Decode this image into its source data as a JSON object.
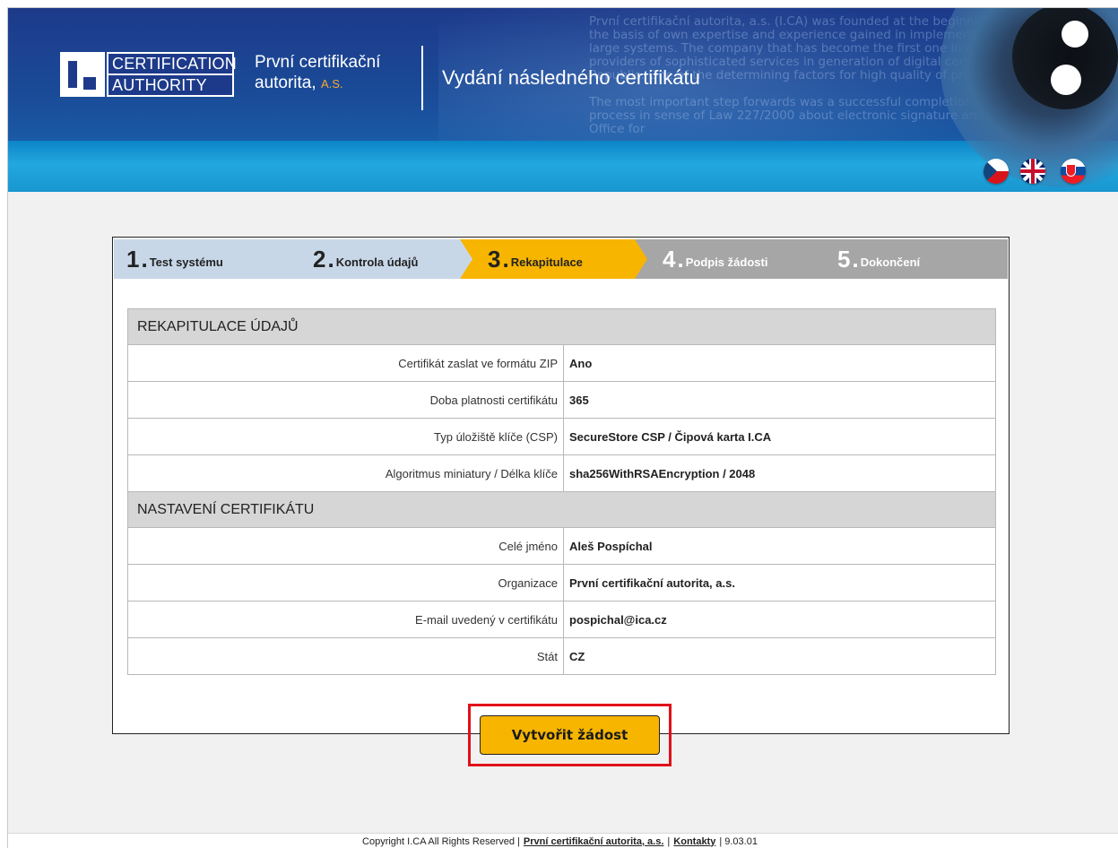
{
  "header": {
    "logo_line1": "CERTIFICATION",
    "logo_line2": "AUTHORITY",
    "org_name_line1": "První certifikační",
    "org_name_line2": "autorita,",
    "org_name_suffix": "A.S.",
    "page_title": "Vydání následného certifikátu",
    "bg_text_1": "První certifikační autorita, a.s. (I.CA) was founded at the beginning of the year 2001 on the basis of own expertise and experience gained in implementation and operation of large systems. The company that has become the first one in a field of commercial providers of sophisticated services in generation of digital certificates in the Czech Republic. One of the determining factors for high quality of provided services.",
    "bg_text_2": "The most important step forwards was a successful completion of accreditation process in sense of Law 227/2000 about electronic signature and coherent edicts. The Office for",
    "languages": [
      "cz-flag-icon",
      "uk-flag-icon",
      "sk-flag-icon"
    ]
  },
  "steps": [
    {
      "num": "1",
      "label": "Test systému",
      "state": "done"
    },
    {
      "num": "2",
      "label": "Kontrola údajů",
      "state": "done"
    },
    {
      "num": "3",
      "label": "Rekapitulace",
      "state": "active"
    },
    {
      "num": "4",
      "label": "Podpis žádosti",
      "state": "todo"
    },
    {
      "num": "5",
      "label": "Dokončení",
      "state": "todo"
    }
  ],
  "recap": {
    "section1_title": "REKAPITULACE ÚDAJŮ",
    "section1_rows": [
      {
        "label": "Certifikát zaslat ve formátu ZIP",
        "value": "Ano"
      },
      {
        "label": "Doba platnosti certifikátu",
        "value": "365"
      },
      {
        "label": "Typ úložiště klíče (CSP)",
        "value": "SecureStore CSP / Čipová karta I.CA"
      },
      {
        "label": "Algoritmus miniatury / Délka klíče",
        "value": "sha256WithRSAEncryption / 2048"
      }
    ],
    "section2_title": "NASTAVENÍ CERTIFIKÁTU",
    "section2_rows": [
      {
        "label": "Celé jméno",
        "value": "Aleš Pospíchal"
      },
      {
        "label": "Organizace",
        "value": "První certifikační autorita, a.s."
      },
      {
        "label": "E-mail uvedený v certifikátu",
        "value": "pospichal@ica.cz"
      },
      {
        "label": "Stát",
        "value": "CZ"
      }
    ]
  },
  "actions": {
    "create_request_label": "Vytvořit žádost"
  },
  "footer": {
    "copyright": "Copyright I.CA All Rights Reserved |",
    "company_link": "První certifikační autorita, a.s.",
    "sep": "|",
    "contacts_link": "Kontakty",
    "version": "| 9.03.01"
  },
  "colors": {
    "header_blue": "#1d3a8a",
    "accent_yellow": "#f7b500",
    "step_done": "#c8d7e8",
    "step_todo": "#a6a6a6",
    "highlight_red": "#e0101a"
  }
}
